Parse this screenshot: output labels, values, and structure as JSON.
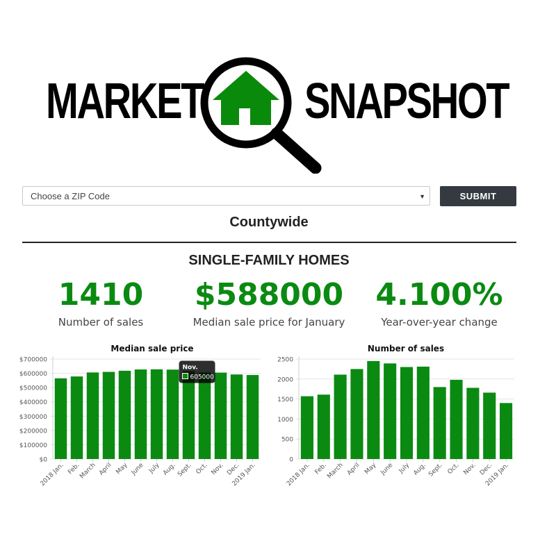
{
  "logo": {
    "word_left": "MARKET",
    "word_right": "SNAPSHOT"
  },
  "search": {
    "placeholder": "Choose a ZIP Code",
    "submit_label": "SUBMIT"
  },
  "region_title": "Countywide",
  "section_title": "SINGLE-FAMILY HOMES",
  "stats": [
    {
      "value": "1410",
      "label": "Number of sales"
    },
    {
      "value": "$588000",
      "label": "Median sale price for January"
    },
    {
      "value": "4.100%",
      "label": "Year-over-year change"
    }
  ],
  "colors": {
    "accent": "#0b8a12",
    "button": "#343a40",
    "house": "#0a8a0a"
  },
  "chart_data": [
    {
      "type": "bar",
      "title": "Median sale price",
      "categories": [
        "2018 Jan.",
        "Feb.",
        "March",
        "April",
        "May",
        "June",
        "July",
        "Aug.",
        "Sept.",
        "Oct.",
        "Nov.",
        "Dec.",
        "2019 Jan."
      ],
      "values": [
        565000,
        578000,
        606000,
        610000,
        618000,
        627000,
        628000,
        626000,
        615000,
        606000,
        605000,
        592000,
        588000
      ],
      "ylim": [
        0,
        700000
      ],
      "yticks": [
        0,
        100000,
        200000,
        300000,
        400000,
        500000,
        600000,
        700000
      ],
      "ytick_labels": [
        "$0",
        "$100000",
        "$200000",
        "$300000",
        "$400000",
        "$500000",
        "$600000",
        "$700000"
      ],
      "color": "#0b8a12",
      "grid": true,
      "tooltip": {
        "category": "Nov.",
        "value": "605000"
      }
    },
    {
      "type": "bar",
      "title": "Number of sales",
      "categories": [
        "2018 Jan.",
        "Feb.",
        "March",
        "April",
        "May",
        "June",
        "July",
        "Aug.",
        "Sept.",
        "Oct.",
        "Nov.",
        "Dec.",
        "2019 Jan."
      ],
      "values": [
        1570,
        1610,
        2110,
        2250,
        2450,
        2390,
        2300,
        2310,
        1800,
        1980,
        1780,
        1660,
        1400
      ],
      "ylim": [
        0,
        2500
      ],
      "yticks": [
        0,
        500,
        1000,
        1500,
        2000,
        2500
      ],
      "ytick_labels": [
        "0",
        "500",
        "1000",
        "1500",
        "2000",
        "2500"
      ],
      "color": "#0b8a12",
      "grid": true
    }
  ]
}
